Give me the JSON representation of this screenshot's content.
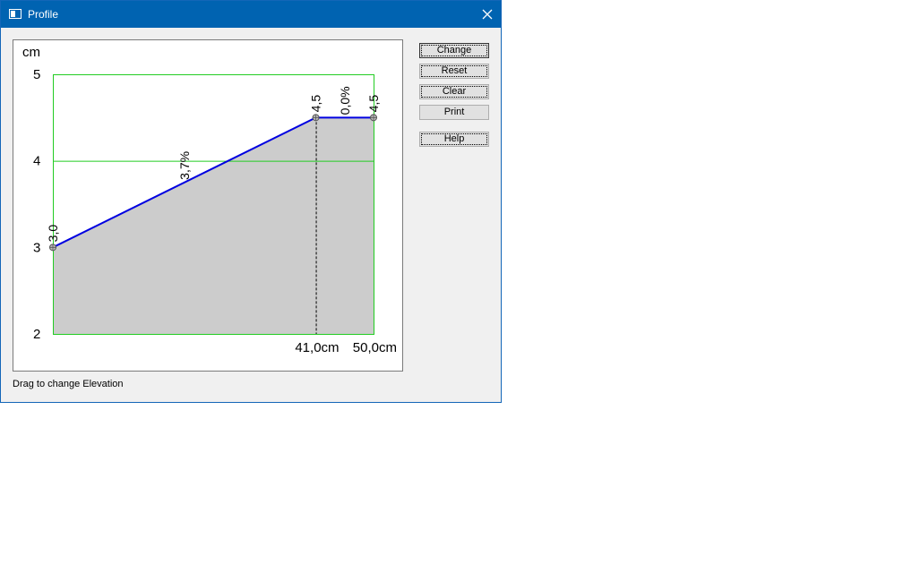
{
  "window": {
    "title": "Profile"
  },
  "buttons": {
    "change": "Change",
    "reset": "Reset",
    "clear": "Clear",
    "print": "Print",
    "help": "Help"
  },
  "status_text": "Drag to change Elevation",
  "chart_data": {
    "type": "area",
    "ylabel": "cm",
    "ylim": [
      2,
      5
    ],
    "y_ticks": [
      "5",
      "4",
      "3",
      "2"
    ],
    "xlim": [
      0,
      50
    ],
    "points": [
      {
        "x": 0,
        "y": 3.0,
        "label": "3,0"
      },
      {
        "x": 41,
        "y": 4.5,
        "label": "4,5"
      },
      {
        "x": 50,
        "y": 4.5,
        "label": "4,5"
      }
    ],
    "segment_labels": [
      "3,7%",
      "0,0%"
    ],
    "x_labels": [
      {
        "x": 41,
        "label": "41,0cm"
      },
      {
        "x": 50,
        "label": "50,0cm"
      }
    ],
    "grid_y": [
      4
    ],
    "colors": {
      "line": "#0000e0",
      "fill": "#cccccc",
      "frame": "#22cc22"
    }
  }
}
